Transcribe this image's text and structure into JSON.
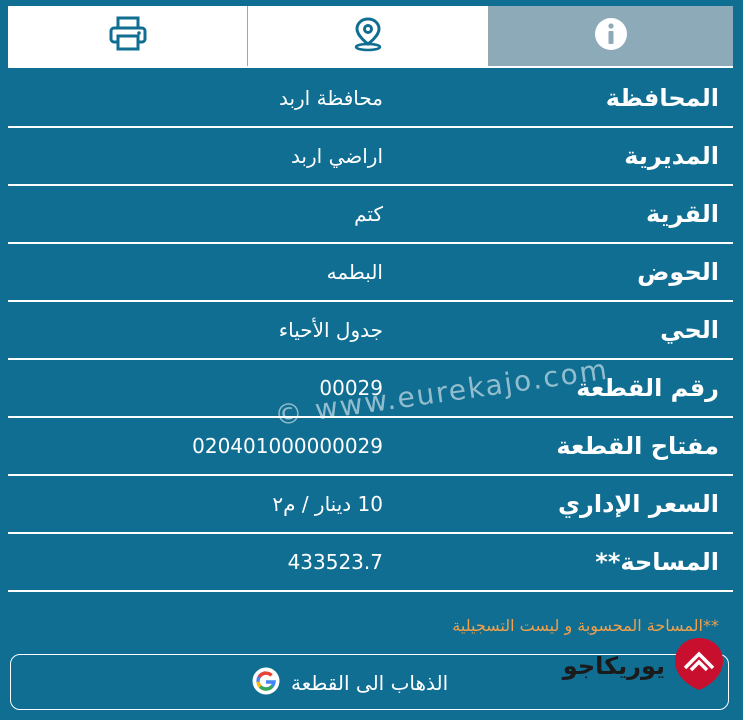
{
  "tabs": {
    "print_icon": "printer-icon",
    "location_icon": "map-pin-icon",
    "info_icon": "info-icon"
  },
  "rows": [
    {
      "label": "المحافظة",
      "value": "محافظة اربد"
    },
    {
      "label": "المديرية",
      "value": "اراضي اربد"
    },
    {
      "label": "القرية",
      "value": "كتم"
    },
    {
      "label": "الحوض",
      "value": "البطمه"
    },
    {
      "label": "الحي",
      "value": "جدول الأحياء"
    },
    {
      "label": "رقم القطعة",
      "value": "00029"
    },
    {
      "label": "مفتاح القطعة",
      "value": "020401000000029"
    },
    {
      "label": "السعر الإداري",
      "value": "10 دينار / م٢"
    },
    {
      "label": "المساحة**",
      "value": "433523.7"
    }
  ],
  "note": "**المساحة المحسوبة و ليست التسجيلية",
  "go_button": {
    "label": "الذهاب الى القطعة",
    "icon": "google-icon"
  },
  "logo": {
    "text": "يوريكاجو"
  },
  "watermark": "© www.eurekajo.com",
  "colors": {
    "background": "#0f6e92",
    "accent": "#f0a04a",
    "active_tab": "#8daab9"
  }
}
